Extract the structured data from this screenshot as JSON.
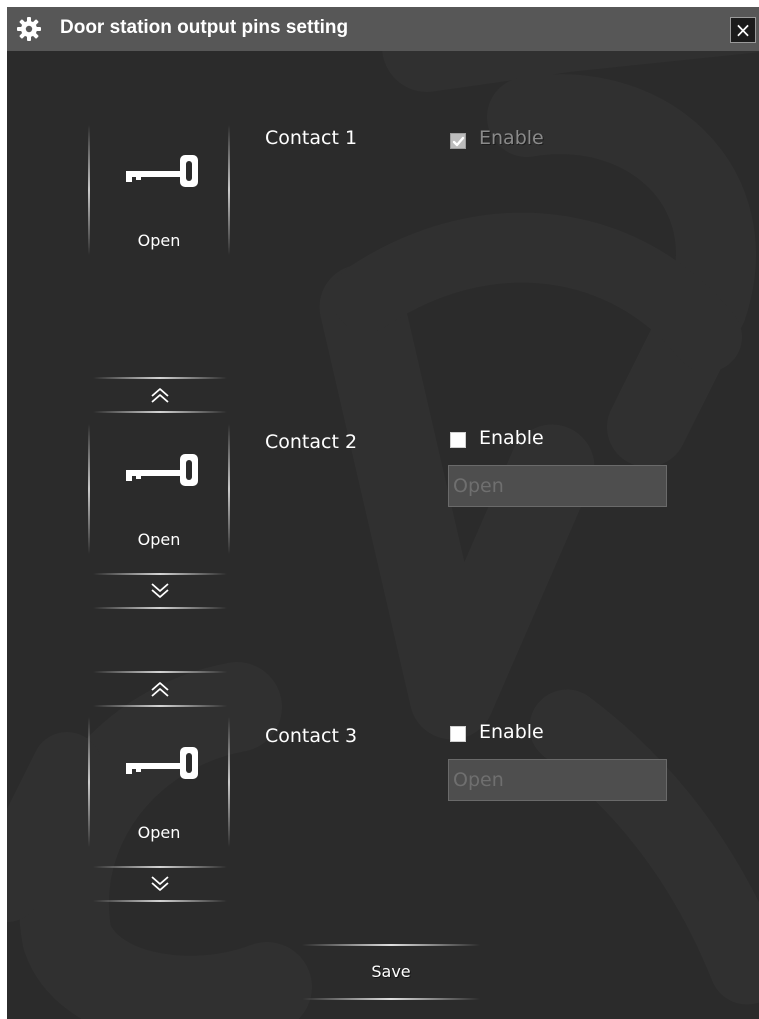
{
  "window": {
    "title": "Door station output pins setting",
    "close_symbol": "×",
    "icon": "gear-icon"
  },
  "contacts": [
    {
      "name": "Contact 1",
      "tile_label": "Open",
      "enable_label": "Enable",
      "enabled": true,
      "enable_disabled": true,
      "icon": "key-icon"
    },
    {
      "name": "Contact 2",
      "tile_label": "Open",
      "enable_label": "Enable",
      "enabled": false,
      "input_placeholder": "Open",
      "icon": "key-icon",
      "arrows": [
        "move-up-icon",
        "move-down-icon"
      ]
    },
    {
      "name": "Contact 3",
      "tile_label": "Open",
      "enable_label": "Enable",
      "enabled": false,
      "input_placeholder": "Open",
      "icon": "key-icon",
      "arrows": [
        "move-up-icon",
        "move-down-icon"
      ]
    }
  ],
  "footer": {
    "save_label": "Save"
  },
  "colors": {
    "window_bg": "#2b2b2b",
    "titlebar_bg": "#575757",
    "input_bg": "#4e4e4e",
    "text": "#ffffff"
  }
}
